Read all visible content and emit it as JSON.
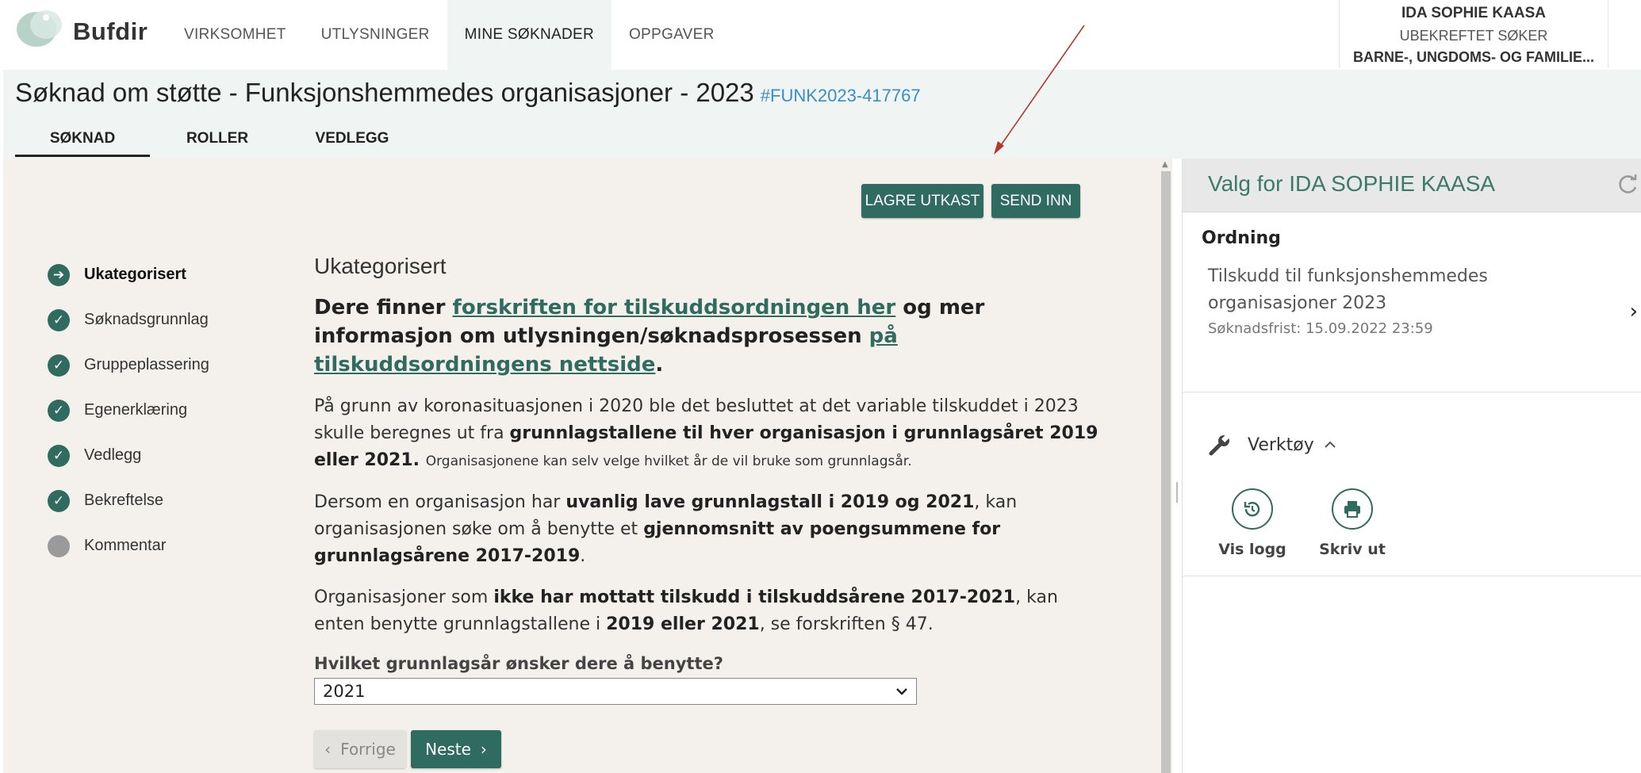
{
  "brand": {
    "name": "Bufdir"
  },
  "nav": {
    "items": [
      {
        "label": "VIRKSOMHET",
        "active": false
      },
      {
        "label": "UTLYSNINGER",
        "active": false
      },
      {
        "label": "MINE SØKNADER",
        "active": true
      },
      {
        "label": "OPPGAVER",
        "active": false
      }
    ]
  },
  "user": {
    "name": "IDA SOPHIE KAASA",
    "role": "UBEKREFTET SØKER",
    "org": "BARNE-, UNGDOMS- OG FAMILIE..."
  },
  "header": {
    "title": "Søknad om støtte - Funksjonshemmedes organisasjoner - 2023",
    "case_id": "#FUNK2023-417767",
    "tabs": [
      "SØKNAD",
      "ROLLER",
      "VEDLEGG"
    ]
  },
  "actions": {
    "save_label": "LAGRE UTKAST",
    "send_label": "SEND INN"
  },
  "steps": [
    {
      "label": "Ukategorisert",
      "state": "current"
    },
    {
      "label": "Søknadsgrunnlag",
      "state": "done"
    },
    {
      "label": "Gruppeplassering",
      "state": "done"
    },
    {
      "label": "Egenerklæring",
      "state": "done"
    },
    {
      "label": "Vedlegg",
      "state": "done"
    },
    {
      "label": "Bekreftelse",
      "state": "done"
    },
    {
      "label": "Kommentar",
      "state": "pending"
    }
  ],
  "content": {
    "section_title": "Ukategorisert",
    "lead": {
      "t1": "Dere finner ",
      "link1": "forskriften for tilskuddsordningen her",
      "t2": " og mer informasjon om utlysningen/søknadsprosessen ",
      "link2": "på tilskuddsordningens nettside",
      "t3": "."
    },
    "p1": {
      "t1": "På grunn av koronasituasjonen i 2020 ble det besluttet at det variable tilskuddet i 2023 skulle beregnes ut fra ",
      "b1": "grunnlagstallene til hver organisasjon i grunnlagsåret 2019 eller 2021",
      "t2": ". ",
      "small": "Organisasjonene kan selv velge hvilket år de vil bruke som grunnlagsår."
    },
    "p2": {
      "t1": "Dersom en organisasjon har ",
      "b1": "uvanlig lave grunnlagstall i 2019 og 2021",
      "t2": ", kan organisasjonen søke om å benytte et ",
      "b2": "gjennomsnitt av poengsummene for grunnlagsårene 2017-2019",
      "t3": "."
    },
    "p3": {
      "t1": "Organisasjoner som ",
      "b1": "ikke har mottatt tilskudd i tilskuddsårene 2017-2021",
      "t2": ", kan enten benytte grunnlagstallene i ",
      "b2": "2019 eller 2021",
      "t3": ", se forskriften § 47."
    },
    "field_label": "Hvilket grunnlagsår ønsker dere å benytte?",
    "select_value": "2021",
    "prev_label": "Forrige",
    "next_label": "Neste"
  },
  "panel": {
    "title": "Valg for IDA SOPHIE KAASA",
    "ordning_label": "Ordning",
    "ordning_name": "Tilskudd til funksjonshemmedes organisasjoner 2023",
    "deadline": "Søknadsfrist: 15.09.2022 23:59",
    "tools_label": "Verktøy",
    "tool_log": "Vis logg",
    "tool_print": "Skriv ut"
  },
  "colors": {
    "primary": "#2f6b5e",
    "link": "#3a8ec4",
    "annotation": "#b03a2e"
  }
}
